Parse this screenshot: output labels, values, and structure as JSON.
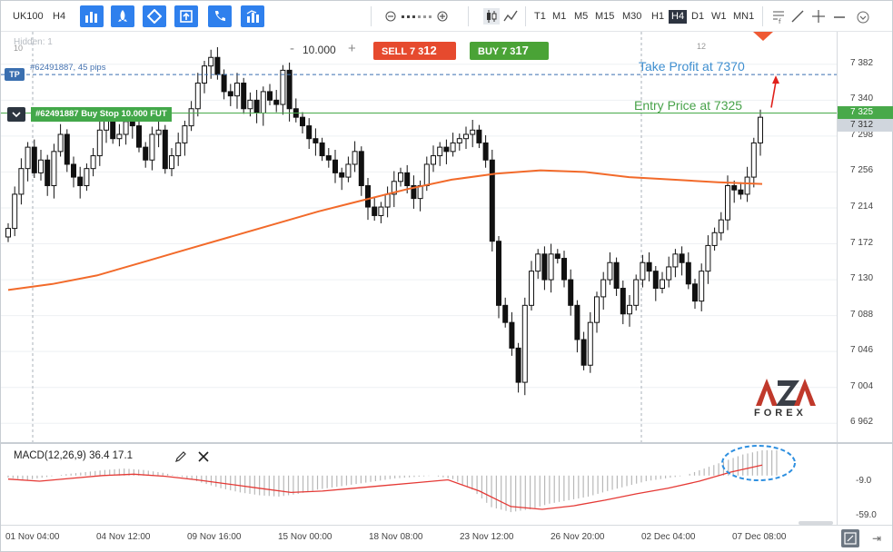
{
  "toolbar": {
    "symbol": "UK100",
    "timeframe": "H4",
    "timeframes": [
      "T1",
      "M1",
      "M5",
      "M15",
      "M30",
      "H1",
      "H4",
      "D1",
      "W1",
      "MN1"
    ],
    "active_timeframe": "H4"
  },
  "chart": {
    "hidden_label": "Hidden: 1",
    "top_labels": [
      "10",
      "12"
    ]
  },
  "order_panel": {
    "lot_minus": "-",
    "lot_value": "10.000",
    "lot_plus": "+",
    "sell_label": "SELL",
    "sell_price_small": "7 3",
    "sell_price_big": "12",
    "buy_label": "BUY",
    "buy_price_small": "7 3",
    "buy_price_big": "17"
  },
  "orders": {
    "tp_tag": "TP",
    "tp_text": "#62491887, 45 pips",
    "order_text": "#62491887 Buy Stop 10.000 FUT",
    "take_profit_note": "Take Profit at 7370",
    "entry_note": "Entry Price at 7325",
    "entry_price_tag": "7 325",
    "current_price_tag": "7 312"
  },
  "price_axis": [
    "7 382",
    "7 340",
    "7 298",
    "7 256",
    "7 214",
    "7 172",
    "7 130",
    "7 088",
    "7 046",
    "7 004",
    "6 962"
  ],
  "macd": {
    "title": "MACD(12,26,9) 36.4 17.1",
    "axis": [
      "-9.0",
      "-59.0"
    ]
  },
  "time_axis": [
    "01 Nov 04:00",
    "04 Nov 12:00",
    "09 Nov 16:00",
    "15 Nov 00:00",
    "18 Nov 08:00",
    "23 Nov 12:00",
    "26 Nov 20:00",
    "02 Dec 04:00",
    "07 Dec 08:00"
  ],
  "logo": {
    "mark": "AZA",
    "word": "FOREX"
  },
  "colors": {
    "accent": "#2f80ed",
    "sell": "#e64a2e",
    "buy": "#4aa336",
    "ma_line": "#f26a2a",
    "tp_line": "#3a6fb0",
    "entry_line": "#48a94a",
    "macd_signal": "#e53935",
    "macd_hist": "#b8b8b8",
    "annotation_ellipse": "#2d8fe0"
  },
  "icons": [
    "bar-chart-icon",
    "rocket-icon",
    "diamond-icon",
    "export-icon",
    "phone-icon",
    "stats-icon",
    "zoom-out-icon",
    "zoom-in-icon",
    "candles-icon",
    "line-chart-icon",
    "indicators-icon",
    "draw-line-icon",
    "crosshair-icon",
    "chevron-down-icon",
    "pencil-icon",
    "close-icon"
  ],
  "chart_data": {
    "type": "candlestick",
    "title": "",
    "symbol": "UK100",
    "timeframe": "H4",
    "ylim": [
      6940,
      7420
    ],
    "take_profit": 7370,
    "entry": 7325,
    "current": 7312,
    "candles_close": [
      7190,
      7230,
      7260,
      7285,
      7255,
      7270,
      7240,
      7280,
      7300,
      7265,
      7250,
      7240,
      7260,
      7275,
      7305,
      7320,
      7295,
      7300,
      7315,
      7310,
      7285,
      7270,
      7300,
      7305,
      7260,
      7275,
      7290,
      7310,
      7330,
      7360,
      7380,
      7390,
      7370,
      7350,
      7345,
      7360,
      7330,
      7340,
      7325,
      7350,
      7340,
      7335,
      7375,
      7330,
      7320,
      7310,
      7295,
      7290,
      7275,
      7270,
      7255,
      7250,
      7265,
      7280,
      7240,
      7215,
      7205,
      7215,
      7230,
      7245,
      7255,
      7240,
      7225,
      7240,
      7265,
      7275,
      7285,
      7280,
      7290,
      7295,
      7300,
      7305,
      7290,
      7270,
      7175,
      7100,
      7080,
      7050,
      7010,
      7100,
      7140,
      7160,
      7130,
      7160,
      7155,
      7130,
      7100,
      7060,
      7030,
      7080,
      7110,
      7130,
      7150,
      7120,
      7090,
      7100,
      7130,
      7150,
      7140,
      7120,
      7130,
      7145,
      7160,
      7150,
      7125,
      7105,
      7140,
      7170,
      7185,
      7200,
      7240,
      7235,
      7230,
      7250,
      7290,
      7320
    ],
    "moving_average": [
      7118,
      7125,
      7135,
      7150,
      7165,
      7180,
      7195,
      7210,
      7223,
      7236,
      7247,
      7254,
      7258,
      7256,
      7250,
      7247,
      7244,
      7242
    ],
    "macd_signal": [
      -5,
      -8,
      -4,
      0,
      2,
      -1,
      -6,
      -12,
      -18,
      -24,
      -22,
      -18,
      -14,
      -10,
      -6,
      -22,
      -44,
      -48,
      -43,
      -35,
      -26,
      -18,
      -8,
      5,
      15
    ],
    "macd_hist": [
      -3,
      -6,
      -2,
      2,
      5,
      8,
      10,
      8,
      4,
      -2,
      -10,
      -18,
      -24,
      -28,
      -30,
      -26,
      -20,
      -16,
      -12,
      -8,
      -4,
      -2,
      0,
      -5,
      -20,
      -45,
      -52,
      -48,
      -40,
      -35,
      -30,
      -22,
      -15,
      -8,
      -4,
      0,
      10,
      20,
      30,
      36
    ]
  }
}
